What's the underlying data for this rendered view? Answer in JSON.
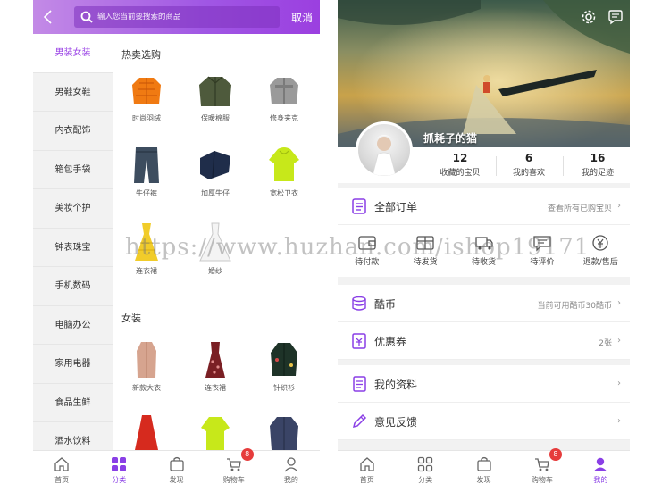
{
  "left": {
    "search": {
      "placeholder": "输入您当前要搜索的商品",
      "cancel": "取消"
    },
    "categories": [
      "男装女装",
      "男鞋女鞋",
      "内衣配饰",
      "箱包手袋",
      "美妆个护",
      "钟表珠宝",
      "手机数码",
      "电脑办公",
      "家用电器",
      "食品生鲜",
      "酒水饮料"
    ],
    "sections": [
      {
        "title": "热卖选购",
        "items": [
          "时尚羽绒",
          "保暖棉服",
          "修身夹克",
          "牛仔裤",
          "加厚牛仔",
          "宽松卫衣",
          "连衣裙",
          "婚纱"
        ]
      },
      {
        "title": "女装",
        "items": [
          "新款大衣",
          "连衣裙",
          "针织衫"
        ]
      }
    ]
  },
  "right": {
    "username": "抓耗子的猫",
    "stats": [
      {
        "num": "12",
        "label": "收藏的宝贝"
      },
      {
        "num": "6",
        "label": "我的喜欢"
      },
      {
        "num": "16",
        "label": "我的足迹"
      }
    ],
    "orders": {
      "label": "全部订单",
      "hint": "查看所有已购宝贝"
    },
    "order_states": [
      "待付款",
      "待发货",
      "待收货",
      "待评价",
      "退款/售后"
    ],
    "coins": {
      "label": "酷币",
      "hint": "当前可用酷币30酷币"
    },
    "coupons": {
      "label": "优惠券",
      "hint": "2张"
    },
    "profile": {
      "label": "我的资料"
    },
    "feedback": {
      "label": "意见反馈"
    }
  },
  "nav": {
    "left": [
      "首页",
      "分类",
      "发现",
      "购物车",
      "我的"
    ],
    "right": [
      "首页",
      "分类",
      "发现",
      "购物车",
      "我的"
    ],
    "cart_badge": "8"
  },
  "watermark": "https://www.huzhan.com/ishop19171",
  "colors": {
    "accent": "#9b44e6",
    "badge": "#e63c3c"
  }
}
